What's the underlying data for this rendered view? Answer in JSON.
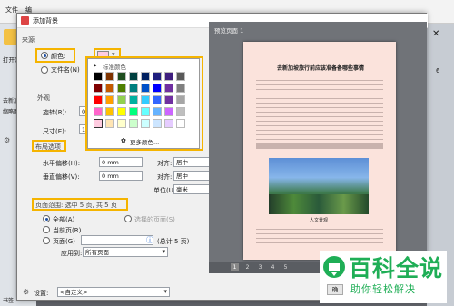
{
  "app": {
    "menu": [
      "文件",
      "编"
    ],
    "open_label": "打开(O)",
    "left_tab": "缩略图",
    "left_tab2": "去新加坡",
    "left_tab3": "书签",
    "right_num": "6"
  },
  "dialog": {
    "title": "添加背景",
    "source_label": "来源",
    "color_label": "颜色:",
    "file_label": "文件名(N)",
    "appearance_label": "外观",
    "rotate_label": "旋转(R):",
    "rotate_value": "0",
    "size_label": "尺寸(E):",
    "size_value": "100%",
    "layout_label": "布局选项",
    "h_offset_label": "水平偏移(H):",
    "h_offset_value": "0 mm",
    "v_offset_label": "垂直偏移(V):",
    "v_offset_value": "0 mm",
    "align_h_label": "对齐:",
    "align_h_value": "居中",
    "align_v_label": "对齐:",
    "align_v_value": "居中",
    "unit_label": "单位(U):",
    "unit_value": "毫米",
    "page_range_label": "页面范围: 选中 5 页, 共 5 页",
    "all_pages": "全部(A)",
    "current_page": "当前页(R)",
    "pages": "页面(G)",
    "pages_total": "(总计 5 页)",
    "selected_pages": "选择的页面(S)",
    "apply_label": "应用到:",
    "apply_value": "所有页面",
    "settings_label": "设置:",
    "settings_value": "<自定义>",
    "ok_button": "确"
  },
  "palette": {
    "standard_label": "标准颜色",
    "more_colors": "更多颜色...",
    "colors": [
      "#000000",
      "#7f3300",
      "#1f4e1f",
      "#004040",
      "#002060",
      "#1f1f7f",
      "#3f1f7f",
      "#595959",
      "#7f0000",
      "#c55a00",
      "#4f7f00",
      "#008080",
      "#0050c8",
      "#0000ff",
      "#6f2fa0",
      "#7f7f7f",
      "#ff0000",
      "#ff9f00",
      "#92d050",
      "#00b0a0",
      "#33ccff",
      "#3366ff",
      "#7030a0",
      "#a6a6a6",
      "#ff66cc",
      "#ffc000",
      "#ffff00",
      "#00ff7f",
      "#66ffff",
      "#66b3ff",
      "#cc66ff",
      "#bfbfbf",
      "#ffcce0",
      "#ffe5b4",
      "#ffffcc",
      "#ccffcc",
      "#ccffff",
      "#cce5ff",
      "#e5ccff",
      "#ffffff"
    ],
    "selected": "#ffcce0"
  },
  "preview": {
    "label": "预览页面 1",
    "doc_title": "去新加坡旅行前应该准备备哪些事情",
    "caption": "人文景观",
    "pages": [
      "1",
      "2",
      "3",
      "4",
      "5"
    ],
    "current_page": "1"
  },
  "watermark": {
    "big": "百科全说",
    "small": "助你轻松解决"
  }
}
